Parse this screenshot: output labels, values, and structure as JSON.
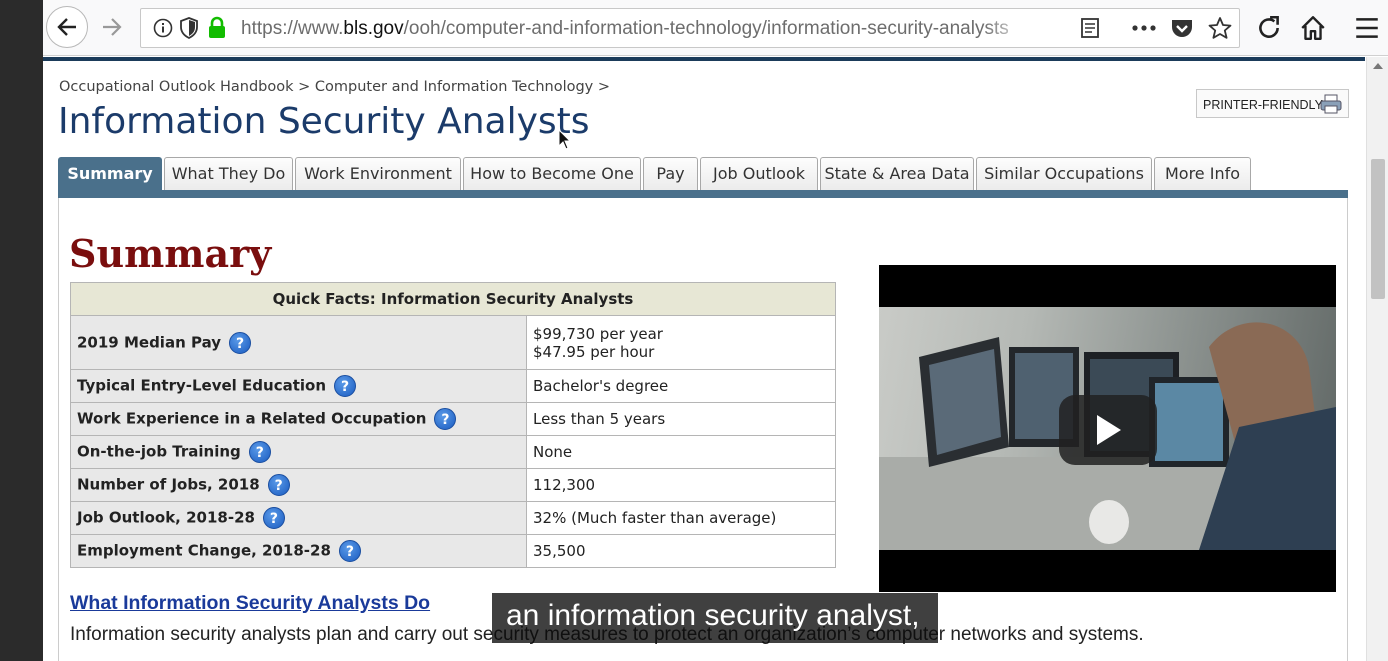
{
  "browser": {
    "url_prefix": "https://www.",
    "url_domain": "bls.gov",
    "url_path": "/ooh/computer-and-information-technology/information-security-analysts",
    "reader_icon": "reader-view-icon",
    "more_icon": "ellipsis-icon",
    "pocket_icon": "pocket-icon",
    "bookmark_icon": "star-icon",
    "reload_icon": "reload-icon",
    "home_icon": "home-icon",
    "menu_icon": "hamburger-icon"
  },
  "page": {
    "breadcrumb": {
      "item1": "Occupational Outlook Handbook",
      "sep1": " > ",
      "item2": "Computer and Information Technology",
      "sep2": " >"
    },
    "title": "Information Security Analysts",
    "printer_label": "PRINTER-FRIENDLY",
    "tabs": [
      {
        "label": "Summary"
      },
      {
        "label": "What They Do"
      },
      {
        "label": "Work Environment"
      },
      {
        "label": "How to Become One"
      },
      {
        "label": "Pay"
      },
      {
        "label": "Job Outlook"
      },
      {
        "label": "State & Area Data"
      },
      {
        "label": "Similar Occupations"
      },
      {
        "label": "More Info"
      }
    ],
    "summary_heading": "Summary",
    "quick_facts": {
      "header": "Quick Facts: Information Security Analysts",
      "rows": [
        {
          "label": "2019 Median Pay",
          "value": "$99,730 per year",
          "value2": "$47.95 per hour"
        },
        {
          "label": "Typical Entry-Level Education",
          "value": "Bachelor's degree"
        },
        {
          "label": "Work Experience in a Related Occupation",
          "value": "Less than 5 years"
        },
        {
          "label": "On-the-job Training",
          "value": "None"
        },
        {
          "label": "Number of Jobs, 2018",
          "value": "112,300"
        },
        {
          "label": "Job Outlook, 2018-28",
          "value": "32% (Much faster than average)"
        },
        {
          "label": "Employment Change, 2018-28",
          "value": "35,500"
        }
      ],
      "help_glyph": "?"
    },
    "what_they_do_link": "What Information Security Analysts Do",
    "intro_text": "Information security analysts plan and carry out security measures to protect an organization’s computer networks and systems."
  },
  "caption": "an information security analyst,",
  "colors": {
    "title": "#1b3b6a",
    "summary_heading": "#7a0e0e",
    "tab_active": "#4a708b",
    "link": "#1a3a9a",
    "lock_green": "#12bc00"
  }
}
